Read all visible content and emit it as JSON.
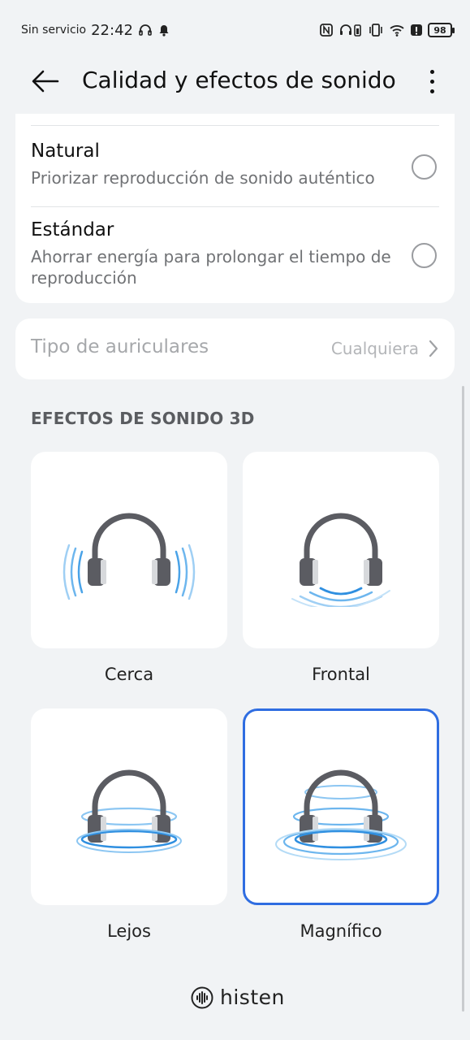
{
  "status_bar": {
    "carrier": "Sin servicio",
    "time": "22:42",
    "battery": "98"
  },
  "header": {
    "title": "Calidad y efectos de sonido"
  },
  "quality_options": [
    {
      "title": "Natural",
      "subtitle": "Priorizar reproducción de sonido auténtico",
      "selected": false
    },
    {
      "title": "Estándar",
      "subtitle": "Ahorrar energía para prolongar el tiempo de reproducción",
      "selected": false
    }
  ],
  "headphone_type": {
    "label": "Tipo de auriculares",
    "value": "Cualquiera"
  },
  "effects_section": {
    "title": "EFECTOS DE SONIDO 3D",
    "tiles": [
      {
        "label": "Cerca",
        "selected": false
      },
      {
        "label": "Frontal",
        "selected": false
      },
      {
        "label": "Lejos",
        "selected": false
      },
      {
        "label": "Magnífico",
        "selected": true
      }
    ]
  },
  "brand": {
    "name": "histen"
  },
  "colors": {
    "accent": "#2f6de1",
    "wave": "#4aa3e8",
    "background": "#f1f3f5"
  }
}
